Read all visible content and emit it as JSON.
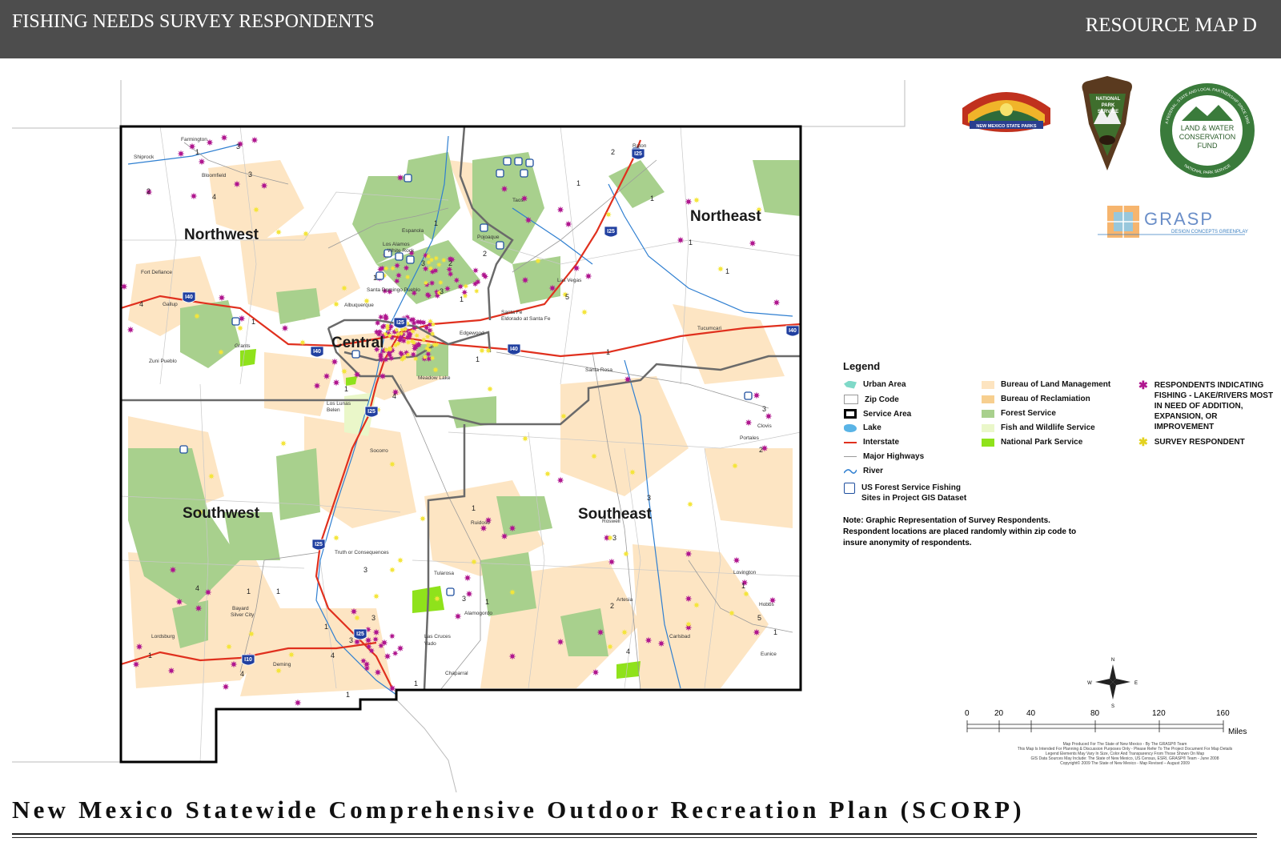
{
  "header": {
    "title_left": "FISHING NEEDS SURVEY RESPONDENTS",
    "title_right": "RESOURCE MAP D"
  },
  "regions": [
    "Northwest",
    "Northeast",
    "Central",
    "Southwest",
    "Southeast"
  ],
  "cities": [
    "Farmington",
    "Shiprock",
    "Bloomfield",
    "Fort Defiance",
    "Gallup",
    "Grants",
    "Zuni Pueblo",
    "Espanola",
    "Los Alamos",
    "White Rock",
    "Pojoaque",
    "Taos",
    "Raton",
    "Las Vegas",
    "Santa Domingo Pueblo",
    "Albuquerque",
    "Santa Fe",
    "Eldorado at Santa Fe",
    "Edgewood",
    "Tucumcari",
    "Santa Rosa",
    "Meadow Lake",
    "Los Lunas",
    "Belen",
    "Clovis",
    "Portales",
    "Socorro",
    "Truth or Consequences",
    "Roswell",
    "Ruidoso",
    "Tularosa",
    "Alamogordo",
    "Lovington",
    "Artesia",
    "Hobbs",
    "Carlsbad",
    "Eunice",
    "Bayard",
    "Silver City",
    "Lordsburg",
    "Deming",
    "Las Cruces",
    "Vado",
    "Chaparral"
  ],
  "highway_labels": [
    "I40",
    "I25",
    "I10"
  ],
  "counts": [
    "1",
    "2",
    "3",
    "4",
    "5"
  ],
  "logos": {
    "nm_state_parks": "NEW MEXICO STATE PARKS",
    "nps_lines": [
      "NATIONAL",
      "PARK",
      "SERVICE"
    ],
    "lwcf_lines": [
      "LAND & WATER",
      "CONSERVATION",
      "FUND"
    ],
    "lwcf_ring_top": "A FEDERAL, STATE AND LOCAL PARTNERSHIP SINCE 1965",
    "lwcf_ring_bottom": "NATIONAL PARK SERVICE",
    "grasp": "GRASP",
    "grasp_sub": "DESIGN CONCEPTS   GREENPLAY"
  },
  "legend": {
    "heading": "Legend",
    "left": [
      {
        "label": "Urban Area",
        "icon": "urban-area-swatch",
        "color": "#7fd9c8"
      },
      {
        "label": "Zip Code",
        "icon": "zip-code-swatch",
        "color": "#ffffff"
      },
      {
        "label": "Service Area",
        "icon": "service-area-swatch",
        "color": "#000000"
      },
      {
        "label": "Lake",
        "icon": "lake-swatch",
        "color": "#5ab4e6"
      },
      {
        "label": "Interstate",
        "icon": "interstate-line",
        "color": "#e0301e"
      },
      {
        "label": "Major Highways",
        "icon": "highway-line",
        "color": "#9a9a9a"
      },
      {
        "label": "River",
        "icon": "river-line",
        "color": "#2f7fd1"
      },
      {
        "label": "US Forest Service Fishing Sites in Project GIS Dataset",
        "icon": "fishing-site-icon",
        "color": "#1f4f9f"
      }
    ],
    "middle": [
      {
        "label": "Bureau of Land Management",
        "color": "#fde4c0"
      },
      {
        "label": "Bureau of Reclamiation",
        "color": "#f7cf8f"
      },
      {
        "label": "Forest Service",
        "color": "#a8d08d"
      },
      {
        "label": "Fish and Wildlife Service",
        "color": "#eaf7c9"
      },
      {
        "label": "National Park Service",
        "color": "#8fe21b"
      }
    ],
    "right": [
      {
        "label": "RESPONDENTS INDICATING FISHING - LAKE/RIVERS MOST IN NEED OF ADDITION, EXPANSION, OR IMPROVEMENT",
        "icon": "respondent-star-icon",
        "color": "#b0178f"
      },
      {
        "label": "SURVEY RESPONDENT",
        "icon": "survey-star-icon",
        "color": "#f4e53a"
      }
    ]
  },
  "note": "Note:  Graphic Representation of Survey Respondents. Respondent locations are placed randomly within zip code to insure anonymity of respondents.",
  "compass": {
    "n": "N",
    "s": "S",
    "e": "E",
    "w": "W"
  },
  "scale": {
    "ticks": [
      "0",
      "20",
      "40",
      "80",
      "120",
      "160"
    ],
    "unit": "Miles"
  },
  "credits": [
    "Map Produced For The State of New Mexico - By The GRASP® Team",
    "This Map Is Intended For Planning & Discussion Purposes Only - Please Refer To The Project Document For Map Details",
    "Legend Elements May Vary In Size, Color And Transparency From Those Shown On Map",
    "GIS Data Sources May Include: The State of New Mexico, US Census, ESRI, GRASP® Team - June 2008",
    "Copyright© 2009 The State of New Mexico - Map Revised – August 2009"
  ],
  "footer_title": "New Mexico Statewide Comprehensive Outdoor Recreation Plan (SCORP)",
  "colors": {
    "header_bg": "#4d4d4d",
    "blm": "#fde4c0",
    "forest": "#a8d08d",
    "interstate": "#e0301e",
    "river": "#2f7fd1",
    "respondent_star": "#b0178f",
    "survey_star": "#f4e53a"
  }
}
